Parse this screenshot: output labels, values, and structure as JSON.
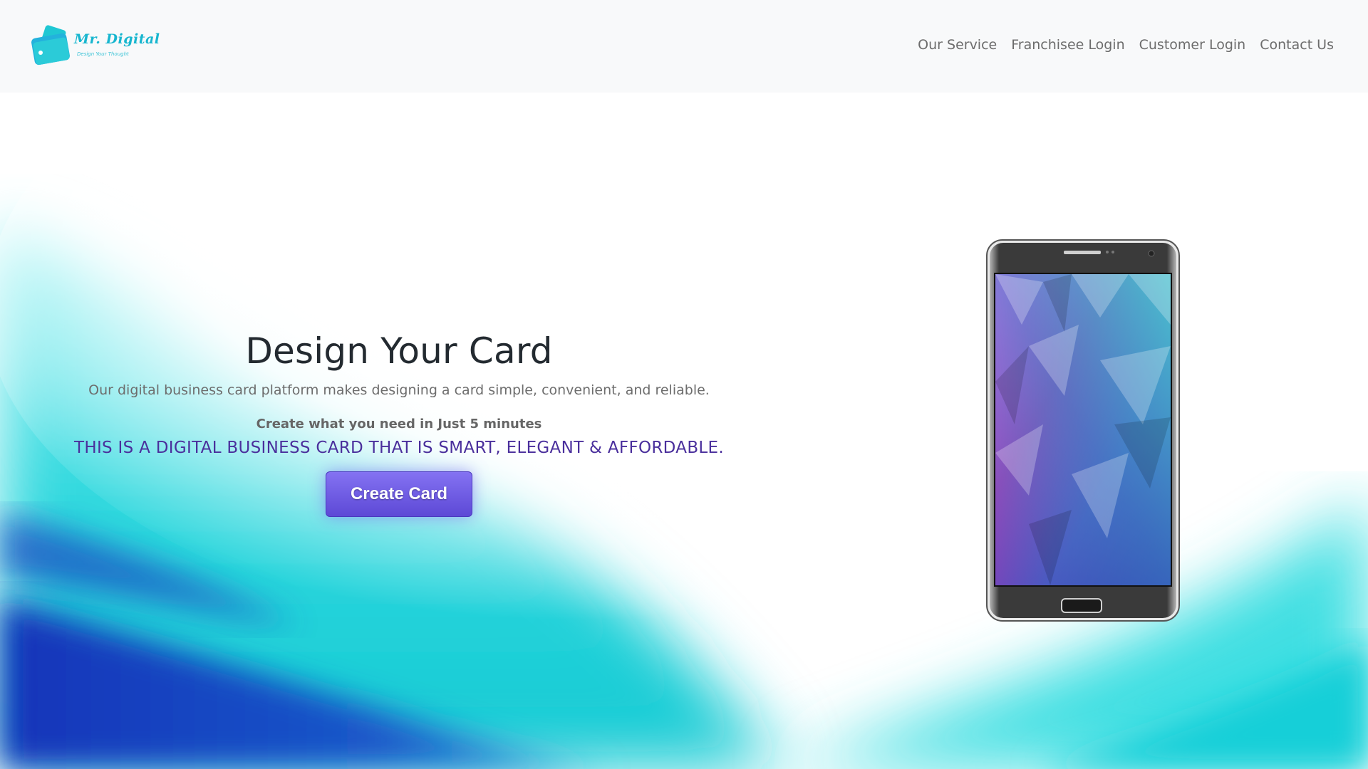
{
  "brand": {
    "name": "Mr. Digital",
    "tagline": "Design Your Thought",
    "colors": {
      "primary": "#17b6cf",
      "accent": "#5d49d6",
      "tagline_text": "#4a2f9c"
    }
  },
  "nav": {
    "items": [
      {
        "label": "Our Service"
      },
      {
        "label": "Franchisee Login"
      },
      {
        "label": "Customer Login"
      },
      {
        "label": "Contact Us"
      }
    ]
  },
  "hero": {
    "title": "Design Your Card",
    "lead": "Our digital business card platform makes designing a card simple, convenient, and reliable.",
    "sub": "Create what you need in Just 5 minutes",
    "tagline": "THIS IS A DIGITAL BUSINESS CARD THAT IS SMART, ELEGANT & AFFORDABLE.",
    "cta_label": "Create Card"
  },
  "icons": {
    "logo": "wallet-card-icon",
    "phone": "smartphone-mockup-icon"
  }
}
